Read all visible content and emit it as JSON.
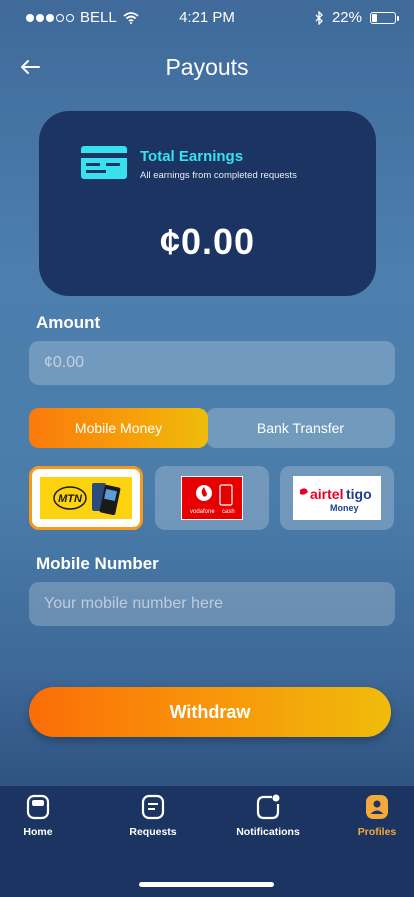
{
  "status_bar": {
    "carrier": "BELL",
    "time": "4:21 PM",
    "battery": "22%",
    "battery_level": 0.22
  },
  "header": {
    "title": "Payouts",
    "back_icon": "arrow-left-icon"
  },
  "earnings_card": {
    "icon": "credit-card-icon",
    "title": "Total Earnings",
    "subtitle": "All earnings from completed requests",
    "amount": "¢0.00"
  },
  "amount_section": {
    "label": "Amount",
    "placeholder": "¢0.00"
  },
  "payout_tabs": [
    {
      "label": "Mobile Money",
      "selected": true
    },
    {
      "label": "Bank Transfer",
      "selected": false
    }
  ],
  "providers": [
    {
      "name": "MTN",
      "logo_text": "MTN",
      "selected": true
    },
    {
      "name": "Vodafone Cash",
      "logo_text": "vodafone",
      "logo_text2": "cash",
      "selected": false
    },
    {
      "name": "AirtelTigo Money",
      "logo_text": "airteltigo",
      "logo_text2": "Money",
      "selected": false
    }
  ],
  "mobile_section": {
    "label": "Mobile Number",
    "placeholder": "Your mobile number here"
  },
  "withdraw_button": {
    "label": "Withdraw"
  },
  "bottom_nav": [
    {
      "label": "Home",
      "icon": "home-icon",
      "active": false
    },
    {
      "label": "Requests",
      "icon": "requests-icon",
      "active": false
    },
    {
      "label": "Notifications",
      "icon": "notifications-icon",
      "active": false
    },
    {
      "label": "Profiles",
      "icon": "profile-icon",
      "active": true
    }
  ],
  "colors": {
    "card_bg": "#1c3461",
    "accent_cyan": "#38e1f0",
    "accent_orange": "#fb7a0b",
    "accent_yellow": "#efbc0b",
    "active_nav": "#f5a93a"
  }
}
